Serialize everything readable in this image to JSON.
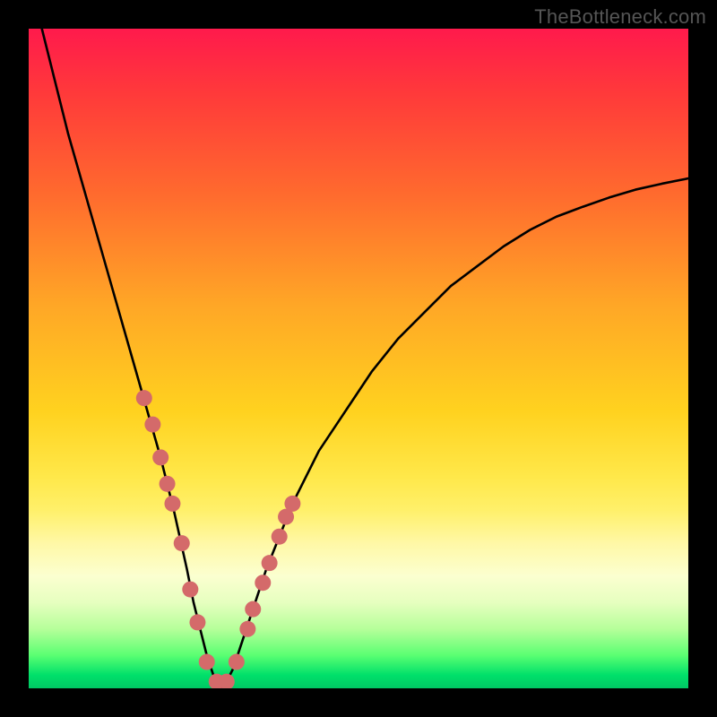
{
  "watermark": "TheBottleneck.com",
  "chart_data": {
    "type": "line",
    "title": "",
    "xlabel": "",
    "ylabel": "",
    "xlim": [
      0,
      100
    ],
    "ylim": [
      0,
      100
    ],
    "grid": false,
    "legend": false,
    "series": [
      {
        "name": "bottleneck-curve",
        "color": "#000000",
        "x": [
          2,
          4,
          6,
          8,
          10,
          12,
          14,
          16,
          18,
          20,
          22,
          24,
          25,
          26,
          27,
          28,
          29,
          30,
          31,
          32,
          34,
          36,
          38,
          40,
          44,
          48,
          52,
          56,
          60,
          64,
          68,
          72,
          76,
          80,
          84,
          88,
          92,
          96,
          100
        ],
        "y": [
          100,
          92,
          84,
          77,
          70,
          63,
          56,
          49,
          42,
          35,
          27,
          18,
          13,
          9,
          5,
          2,
          0,
          1,
          3,
          6,
          12,
          18,
          23,
          28,
          36,
          42,
          48,
          53,
          57,
          61,
          64,
          67,
          69.5,
          71.5,
          73,
          74.4,
          75.6,
          76.5,
          77.3
        ]
      }
    ],
    "markers": {
      "name": "highlight-dots",
      "color": "#d46a6a",
      "radius": 9,
      "x": [
        17.5,
        18.8,
        20,
        21,
        21.8,
        23.2,
        24.5,
        25.6,
        27,
        28.5,
        30,
        31.5,
        33.2,
        34,
        35.5,
        36.5,
        38,
        39,
        40
      ],
      "y": [
        44,
        40,
        35,
        31,
        28,
        22,
        15,
        10,
        4,
        1,
        1,
        4,
        9,
        12,
        16,
        19,
        23,
        26,
        28
      ]
    },
    "minimum_at_x": 29
  }
}
